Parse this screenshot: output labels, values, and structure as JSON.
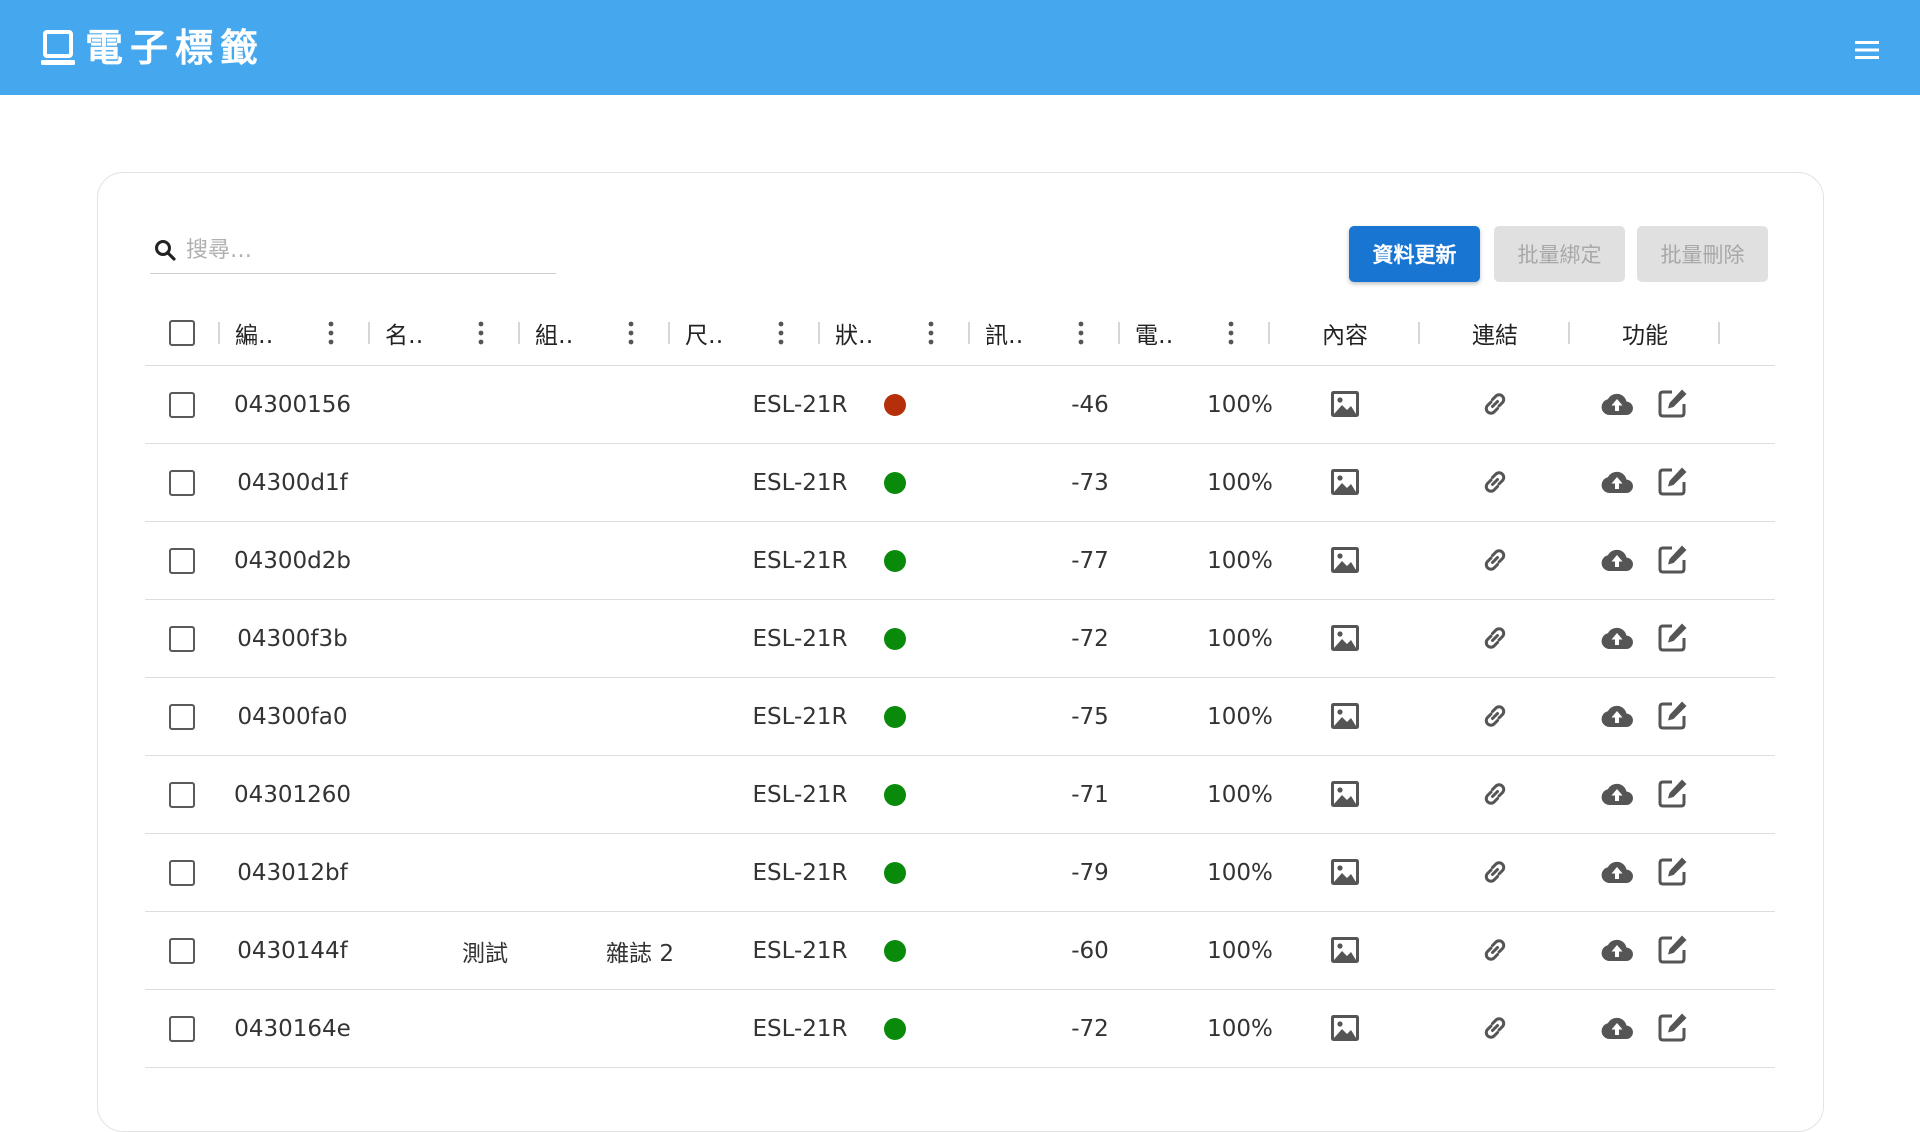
{
  "app": {
    "title": "電子標籤"
  },
  "icons": {
    "brand": "laptop-icon",
    "menu": "hamburger-menu-icon",
    "search": "search-icon",
    "content": "image-icon",
    "link": "link-icon",
    "upload": "cloud-upload-icon",
    "edit": "edit-icon",
    "column_menu": "more-vert-icon"
  },
  "colors": {
    "header_bg": "#45a7ee",
    "primary_button": "#1975d2",
    "status_offline": "#b5300a",
    "status_online": "#0a8a0a"
  },
  "search": {
    "placeholder": "搜尋…",
    "value": ""
  },
  "toolbar": {
    "refresh_label": "資料更新",
    "bulk_bind_label": "批量綁定",
    "bulk_delete_label": "批量刪除"
  },
  "table": {
    "columns": [
      {
        "key": "id",
        "label": "編‥"
      },
      {
        "key": "name",
        "label": "名‥"
      },
      {
        "key": "group",
        "label": "組‥"
      },
      {
        "key": "size",
        "label": "尺‥"
      },
      {
        "key": "status",
        "label": "狀‥"
      },
      {
        "key": "signal",
        "label": "訊‥"
      },
      {
        "key": "battery",
        "label": "電‥"
      },
      {
        "key": "content",
        "label": "內容"
      },
      {
        "key": "link",
        "label": "連結"
      },
      {
        "key": "actions",
        "label": "功能"
      }
    ],
    "rows": [
      {
        "id": "04300156",
        "name": "",
        "group": "",
        "size": "ESL-21R",
        "status": "offline",
        "signal": "-46",
        "battery": "100%"
      },
      {
        "id": "04300d1f",
        "name": "",
        "group": "",
        "size": "ESL-21R",
        "status": "online",
        "signal": "-73",
        "battery": "100%"
      },
      {
        "id": "04300d2b",
        "name": "",
        "group": "",
        "size": "ESL-21R",
        "status": "online",
        "signal": "-77",
        "battery": "100%"
      },
      {
        "id": "04300f3b",
        "name": "",
        "group": "",
        "size": "ESL-21R",
        "status": "online",
        "signal": "-72",
        "battery": "100%"
      },
      {
        "id": "04300fa0",
        "name": "",
        "group": "",
        "size": "ESL-21R",
        "status": "online",
        "signal": "-75",
        "battery": "100%"
      },
      {
        "id": "04301260",
        "name": "",
        "group": "",
        "size": "ESL-21R",
        "status": "online",
        "signal": "-71",
        "battery": "100%"
      },
      {
        "id": "043012bf",
        "name": "",
        "group": "",
        "size": "ESL-21R",
        "status": "online",
        "signal": "-79",
        "battery": "100%"
      },
      {
        "id": "0430144f",
        "name": "測試",
        "group": "雜誌 2",
        "size": "ESL-21R",
        "status": "online",
        "signal": "-60",
        "battery": "100%"
      },
      {
        "id": "0430164e",
        "name": "",
        "group": "",
        "size": "ESL-21R",
        "status": "online",
        "signal": "-72",
        "battery": "100%"
      }
    ]
  }
}
